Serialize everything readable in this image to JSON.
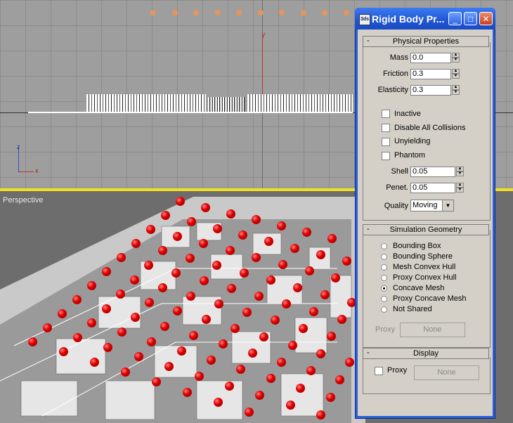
{
  "viewports": {
    "top_axis_labels": {
      "y": "y",
      "z": "z",
      "x": "x"
    },
    "perspective_label": "Perspective"
  },
  "dialog": {
    "title": "Rigid Body Pr...",
    "app_icon_text": "3ds",
    "buttons": {
      "minimize": "_",
      "maximize": "□",
      "close": "✕"
    },
    "physical": {
      "header": "Physical Properties",
      "collapse": "-",
      "mass_label": "Mass",
      "mass_value": "0.0",
      "friction_label": "Friction",
      "friction_value": "0.3",
      "elasticity_label": "Elasticity",
      "elasticity_value": "0.3",
      "checkboxes": [
        {
          "label": "Inactive",
          "checked": false
        },
        {
          "label": "Disable All Collisions",
          "checked": false
        },
        {
          "label": "Unyielding",
          "checked": false
        },
        {
          "label": "Phantom",
          "checked": false
        }
      ],
      "shell_label": "Shell",
      "shell_value": "0.05",
      "penet_label": "Penet.",
      "penet_value": "0.05",
      "quality_label": "Quality",
      "quality_value": "Moving"
    },
    "geometry": {
      "header": "Simulation Geometry",
      "collapse": "-",
      "options": [
        "Bounding Box",
        "Bounding Sphere",
        "Mesh Convex Hull",
        "Proxy Convex Hull",
        "Concave Mesh",
        "Proxy Concave Mesh",
        "Not Shared"
      ],
      "selected": "Concave Mesh",
      "proxy_label": "Proxy",
      "proxy_button": "None"
    },
    "display": {
      "header": "Display",
      "collapse": "-",
      "proxy_label": "Proxy",
      "proxy_checked": false,
      "proxy_button": "None"
    }
  },
  "colors": {
    "title_bar": "#2a5fd6",
    "viewport_active_border": "#f0e020",
    "ball_red": "#e00000",
    "ball_orange": "#e8955a"
  }
}
